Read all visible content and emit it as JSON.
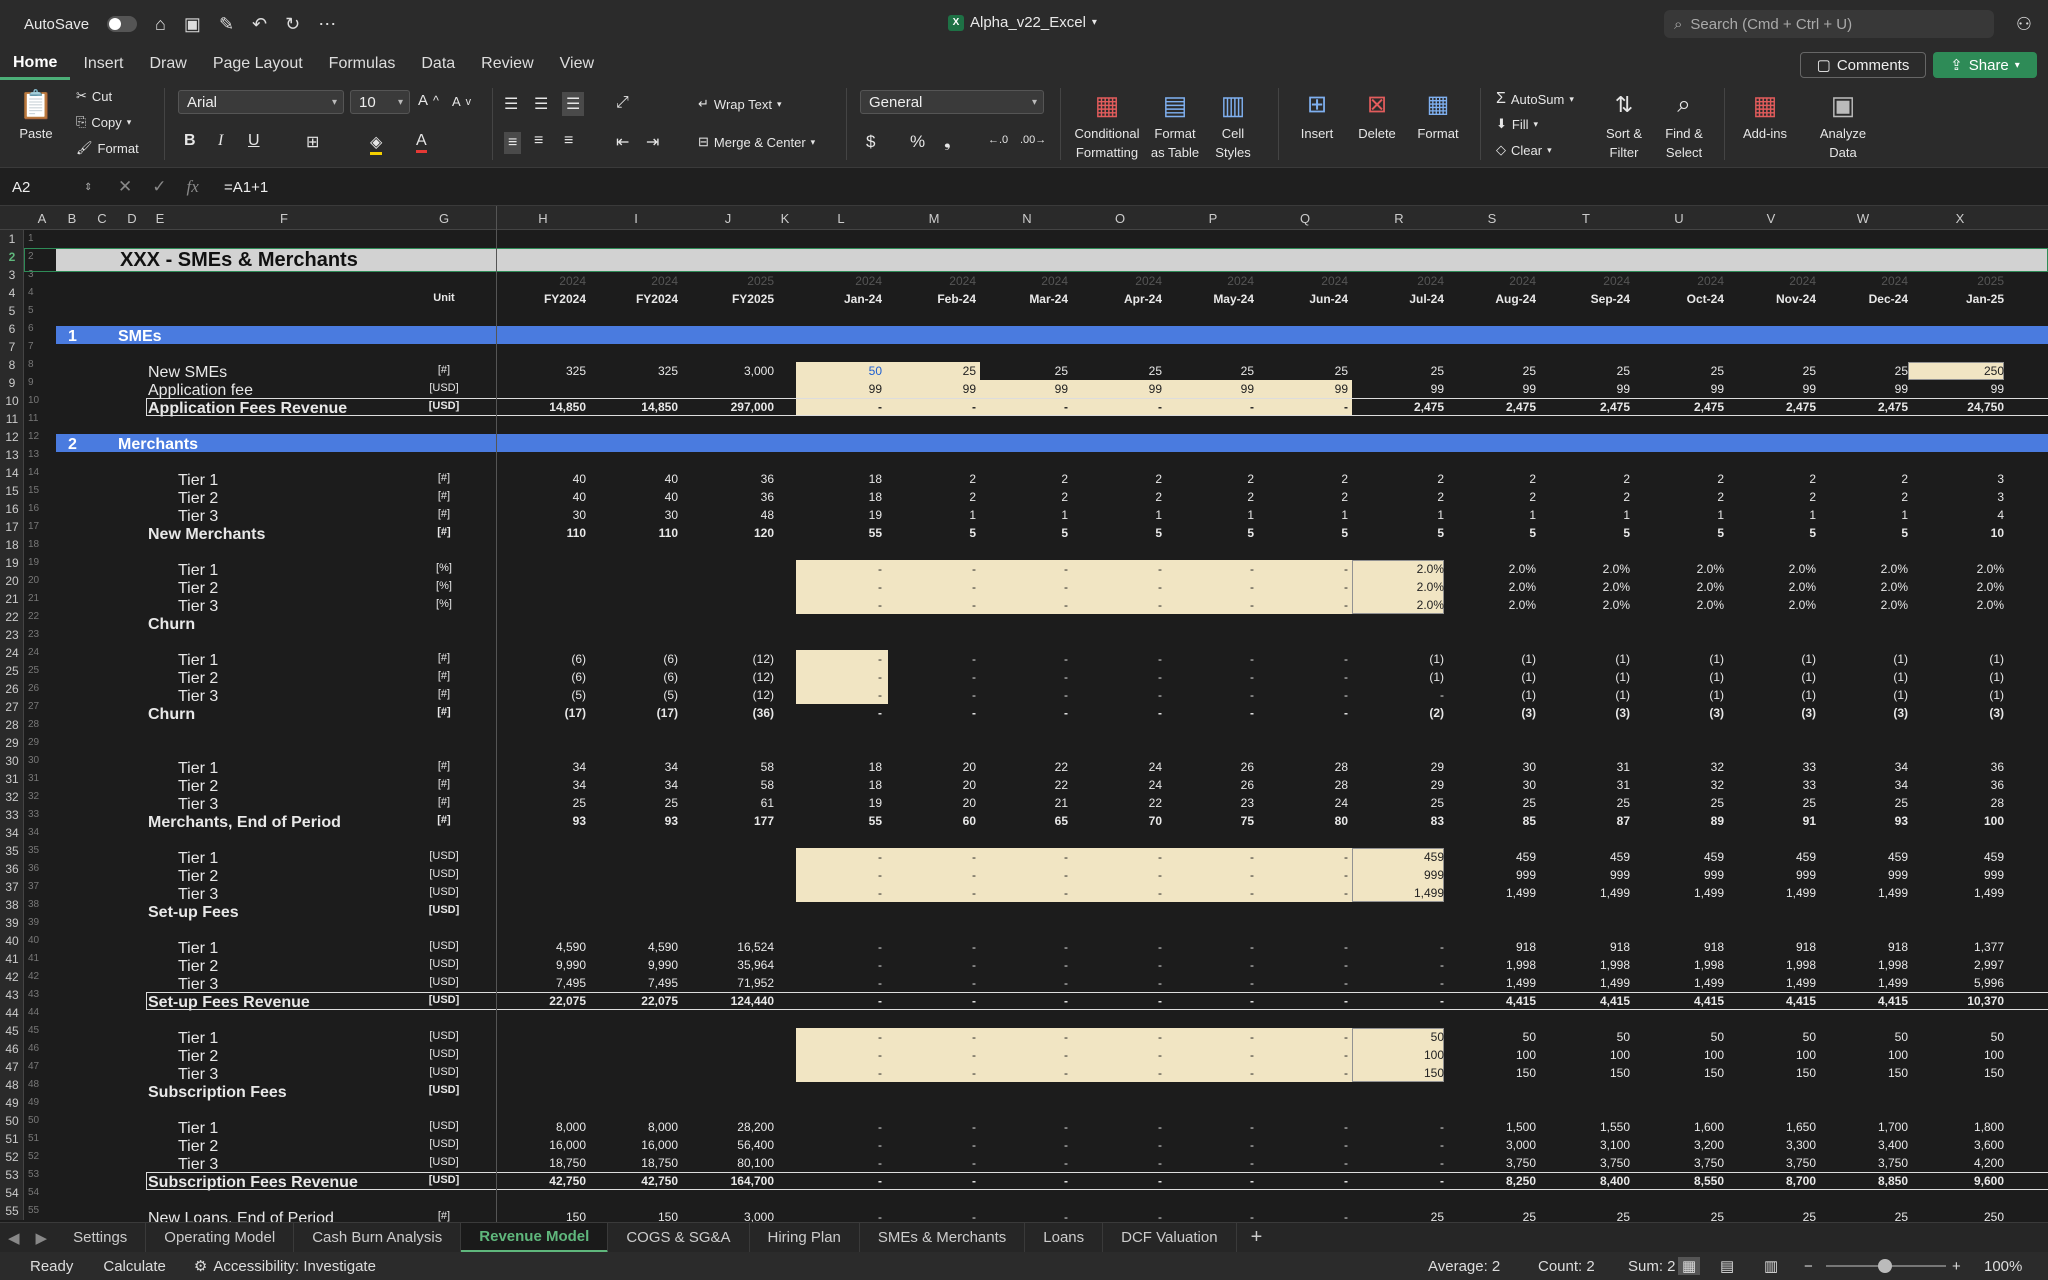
{
  "titlebar": {
    "autosave": "AutoSave",
    "title": "Alpha_v22_Excel",
    "search_placeholder": "Search (Cmd + Ctrl + U)"
  },
  "ribbon_tabs": [
    {
      "label": "Home",
      "active": true
    },
    {
      "label": "Insert"
    },
    {
      "label": "Draw"
    },
    {
      "label": "Page Layout"
    },
    {
      "label": "Formulas"
    },
    {
      "label": "Data"
    },
    {
      "label": "Review"
    },
    {
      "label": "View"
    }
  ],
  "buttons": {
    "comments": "Comments",
    "share": "Share"
  },
  "ribbon": {
    "paste": "Paste",
    "cut": "Cut",
    "copy": "Copy",
    "format": "Format",
    "font": "Arial",
    "size": "10",
    "wrap": "Wrap Text",
    "merge": "Merge & Center",
    "number_format": "General",
    "cond1": "Conditional",
    "cond2": "Formatting",
    "fmt1": "Format",
    "fmt2": "as Table",
    "cell1": "Cell",
    "cell2": "Styles",
    "insert": "Insert",
    "delete": "Delete",
    "format2": "Format",
    "autosum": "AutoSum",
    "fill": "Fill",
    "clear": "Clear",
    "sort1": "Sort &",
    "sort2": "Filter",
    "find1": "Find &",
    "find2": "Select",
    "addins": "Add-ins",
    "analyze1": "Analyze",
    "analyze2": "Data",
    "bold": "B",
    "italic": "I",
    "underline": "U"
  },
  "formula_bar": {
    "cell": "A2",
    "formula": "=A1+1"
  },
  "columns": [
    "A",
    "B",
    "C",
    "D",
    "E",
    "F",
    "G",
    "H",
    "I",
    "J",
    "K",
    "L",
    "M",
    "N",
    "O",
    "P",
    "Q",
    "R",
    "S",
    "T",
    "U",
    "V",
    "W",
    "X"
  ],
  "sheet": {
    "title": "XXX - SMEs & Merchants",
    "year_row": [
      "2024",
      "2024",
      "2025",
      "2024",
      "2024",
      "2024",
      "2024",
      "2024",
      "2024",
      "2024",
      "2024",
      "2024",
      "2024",
      "2024",
      "2024",
      "2025"
    ],
    "unit_header": "Unit",
    "period_row": [
      "FY2024",
      "FY2024",
      "FY2025",
      "Jan-24",
      "Feb-24",
      "Mar-24",
      "Apr-24",
      "May-24",
      "Jun-24",
      "Jul-24",
      "Aug-24",
      "Sep-24",
      "Oct-24",
      "Nov-24",
      "Dec-24",
      "Jan-25"
    ],
    "sections": [
      {
        "row": 6,
        "num": "1",
        "label": "SMEs"
      },
      {
        "row": 12,
        "num": "2",
        "label": "Merchants"
      }
    ],
    "rows": [
      {
        "r": 8,
        "indent": 1,
        "label": "New SMEs",
        "unit": "[#]",
        "v": [
          "325",
          "325",
          "3,000",
          "50",
          "25",
          "25",
          "25",
          "25",
          "25",
          "25",
          "25",
          "25",
          "25",
          "25",
          "25",
          "250"
        ]
      },
      {
        "r": 9,
        "indent": 1,
        "label": "Application fee",
        "unit": "[USD]",
        "v": [
          "",
          "",
          "",
          "99",
          "99",
          "99",
          "99",
          "99",
          "99",
          "99",
          "99",
          "99",
          "99",
          "99",
          "99",
          "99"
        ]
      },
      {
        "r": 10,
        "indent": 1,
        "label": "Application Fees Revenue",
        "unit": "[USD]",
        "bold": true,
        "v": [
          "14,850",
          "14,850",
          "297,000",
          "-",
          "-",
          "-",
          "-",
          "-",
          "-",
          "2,475",
          "2,475",
          "2,475",
          "2,475",
          "2,475",
          "2,475",
          "24,750"
        ]
      },
      {
        "r": 14,
        "indent": 2,
        "label": "Tier 1",
        "unit": "[#]",
        "v": [
          "40",
          "40",
          "36",
          "18",
          "2",
          "2",
          "2",
          "2",
          "2",
          "2",
          "2",
          "2",
          "2",
          "2",
          "2",
          "3"
        ]
      },
      {
        "r": 15,
        "indent": 2,
        "label": "Tier 2",
        "unit": "[#]",
        "v": [
          "40",
          "40",
          "36",
          "18",
          "2",
          "2",
          "2",
          "2",
          "2",
          "2",
          "2",
          "2",
          "2",
          "2",
          "2",
          "3"
        ]
      },
      {
        "r": 16,
        "indent": 2,
        "label": "Tier 3",
        "unit": "[#]",
        "v": [
          "30",
          "30",
          "48",
          "19",
          "1",
          "1",
          "1",
          "1",
          "1",
          "1",
          "1",
          "1",
          "1",
          "1",
          "1",
          "4"
        ]
      },
      {
        "r": 17,
        "indent": 1,
        "label": "New Merchants",
        "unit": "[#]",
        "bold": true,
        "v": [
          "110",
          "110",
          "120",
          "55",
          "5",
          "5",
          "5",
          "5",
          "5",
          "5",
          "5",
          "5",
          "5",
          "5",
          "5",
          "10"
        ]
      },
      {
        "r": 19,
        "indent": 2,
        "label": "Tier 1",
        "unit": "[%]",
        "v": [
          "",
          "",
          "",
          "-",
          "-",
          "-",
          "-",
          "-",
          "-",
          "2.0%",
          "2.0%",
          "2.0%",
          "2.0%",
          "2.0%",
          "2.0%",
          "2.0%"
        ]
      },
      {
        "r": 20,
        "indent": 2,
        "label": "Tier 2",
        "unit": "[%]",
        "v": [
          "",
          "",
          "",
          "-",
          "-",
          "-",
          "-",
          "-",
          "-",
          "2.0%",
          "2.0%",
          "2.0%",
          "2.0%",
          "2.0%",
          "2.0%",
          "2.0%"
        ]
      },
      {
        "r": 21,
        "indent": 2,
        "label": "Tier 3",
        "unit": "[%]",
        "v": [
          "",
          "",
          "",
          "-",
          "-",
          "-",
          "-",
          "-",
          "-",
          "2.0%",
          "2.0%",
          "2.0%",
          "2.0%",
          "2.0%",
          "2.0%",
          "2.0%"
        ]
      },
      {
        "r": 22,
        "indent": 1,
        "label": "Churn",
        "unit": "",
        "bold": true,
        "v": []
      },
      {
        "r": 24,
        "indent": 2,
        "label": "Tier 1",
        "unit": "[#]",
        "v": [
          "(6)",
          "(6)",
          "(12)",
          "-",
          "-",
          "-",
          "-",
          "-",
          "-",
          "(1)",
          "(1)",
          "(1)",
          "(1)",
          "(1)",
          "(1)",
          "(1)"
        ]
      },
      {
        "r": 25,
        "indent": 2,
        "label": "Tier 2",
        "unit": "[#]",
        "v": [
          "(6)",
          "(6)",
          "(12)",
          "-",
          "-",
          "-",
          "-",
          "-",
          "-",
          "(1)",
          "(1)",
          "(1)",
          "(1)",
          "(1)",
          "(1)",
          "(1)"
        ]
      },
      {
        "r": 26,
        "indent": 2,
        "label": "Tier 3",
        "unit": "[#]",
        "v": [
          "(5)",
          "(5)",
          "(12)",
          "-",
          "-",
          "-",
          "-",
          "-",
          "-",
          "-",
          "(1)",
          "(1)",
          "(1)",
          "(1)",
          "(1)",
          "(1)"
        ]
      },
      {
        "r": 27,
        "indent": 1,
        "label": "Churn",
        "unit": "[#]",
        "bold": true,
        "v": [
          "(17)",
          "(17)",
          "(36)",
          "-",
          "-",
          "-",
          "-",
          "-",
          "-",
          "(2)",
          "(3)",
          "(3)",
          "(3)",
          "(3)",
          "(3)",
          "(3)"
        ]
      },
      {
        "r": 30,
        "indent": 2,
        "label": "Tier 1",
        "unit": "[#]",
        "v": [
          "34",
          "34",
          "58",
          "18",
          "20",
          "22",
          "24",
          "26",
          "28",
          "29",
          "30",
          "31",
          "32",
          "33",
          "34",
          "36"
        ]
      },
      {
        "r": 31,
        "indent": 2,
        "label": "Tier 2",
        "unit": "[#]",
        "v": [
          "34",
          "34",
          "58",
          "18",
          "20",
          "22",
          "24",
          "26",
          "28",
          "29",
          "30",
          "31",
          "32",
          "33",
          "34",
          "36"
        ]
      },
      {
        "r": 32,
        "indent": 2,
        "label": "Tier 3",
        "unit": "[#]",
        "v": [
          "25",
          "25",
          "61",
          "19",
          "20",
          "21",
          "22",
          "23",
          "24",
          "25",
          "25",
          "25",
          "25",
          "25",
          "25",
          "28"
        ]
      },
      {
        "r": 33,
        "indent": 1,
        "label": "Merchants, End of Period",
        "unit": "[#]",
        "bold": true,
        "v": [
          "93",
          "93",
          "177",
          "55",
          "60",
          "65",
          "70",
          "75",
          "80",
          "83",
          "85",
          "87",
          "89",
          "91",
          "93",
          "100"
        ]
      },
      {
        "r": 35,
        "indent": 2,
        "label": "Tier 1",
        "unit": "[USD]",
        "v": [
          "",
          "",
          "",
          "-",
          "-",
          "-",
          "-",
          "-",
          "-",
          "459",
          "459",
          "459",
          "459",
          "459",
          "459",
          "459"
        ]
      },
      {
        "r": 36,
        "indent": 2,
        "label": "Tier 2",
        "unit": "[USD]",
        "v": [
          "",
          "",
          "",
          "-",
          "-",
          "-",
          "-",
          "-",
          "-",
          "999",
          "999",
          "999",
          "999",
          "999",
          "999",
          "999"
        ]
      },
      {
        "r": 37,
        "indent": 2,
        "label": "Tier 3",
        "unit": "[USD]",
        "v": [
          "",
          "",
          "",
          "-",
          "-",
          "-",
          "-",
          "-",
          "-",
          "1,499",
          "1,499",
          "1,499",
          "1,499",
          "1,499",
          "1,499",
          "1,499"
        ]
      },
      {
        "r": 38,
        "indent": 1,
        "label": "Set-up Fees",
        "unit": "[USD]",
        "bold": true,
        "v": []
      },
      {
        "r": 40,
        "indent": 2,
        "label": "Tier 1",
        "unit": "[USD]",
        "v": [
          "4,590",
          "4,590",
          "16,524",
          "-",
          "-",
          "-",
          "-",
          "-",
          "-",
          "-",
          "918",
          "918",
          "918",
          "918",
          "918",
          "1,377"
        ]
      },
      {
        "r": 41,
        "indent": 2,
        "label": "Tier 2",
        "unit": "[USD]",
        "v": [
          "9,990",
          "9,990",
          "35,964",
          "-",
          "-",
          "-",
          "-",
          "-",
          "-",
          "-",
          "1,998",
          "1,998",
          "1,998",
          "1,998",
          "1,998",
          "2,997"
        ]
      },
      {
        "r": 42,
        "indent": 2,
        "label": "Tier 3",
        "unit": "[USD]",
        "v": [
          "7,495",
          "7,495",
          "71,952",
          "-",
          "-",
          "-",
          "-",
          "-",
          "-",
          "-",
          "1,499",
          "1,499",
          "1,499",
          "1,499",
          "1,499",
          "5,996"
        ]
      },
      {
        "r": 43,
        "indent": 1,
        "label": "Set-up Fees Revenue",
        "unit": "[USD]",
        "bold": true,
        "v": [
          "22,075",
          "22,075",
          "124,440",
          "-",
          "-",
          "-",
          "-",
          "-",
          "-",
          "-",
          "4,415",
          "4,415",
          "4,415",
          "4,415",
          "4,415",
          "10,370"
        ]
      },
      {
        "r": 45,
        "indent": 2,
        "label": "Tier 1",
        "unit": "[USD]",
        "v": [
          "",
          "",
          "",
          "-",
          "-",
          "-",
          "-",
          "-",
          "-",
          "50",
          "50",
          "50",
          "50",
          "50",
          "50",
          "50"
        ]
      },
      {
        "r": 46,
        "indent": 2,
        "label": "Tier 2",
        "unit": "[USD]",
        "v": [
          "",
          "",
          "",
          "-",
          "-",
          "-",
          "-",
          "-",
          "-",
          "100",
          "100",
          "100",
          "100",
          "100",
          "100",
          "100"
        ]
      },
      {
        "r": 47,
        "indent": 2,
        "label": "Tier 3",
        "unit": "[USD]",
        "v": [
          "",
          "",
          "",
          "-",
          "-",
          "-",
          "-",
          "-",
          "-",
          "150",
          "150",
          "150",
          "150",
          "150",
          "150",
          "150"
        ]
      },
      {
        "r": 48,
        "indent": 1,
        "label": "Subscription Fees",
        "unit": "[USD]",
        "bold": true,
        "v": []
      },
      {
        "r": 50,
        "indent": 2,
        "label": "Tier 1",
        "unit": "[USD]",
        "v": [
          "8,000",
          "8,000",
          "28,200",
          "-",
          "-",
          "-",
          "-",
          "-",
          "-",
          "-",
          "1,500",
          "1,550",
          "1,600",
          "1,650",
          "1,700",
          "1,800"
        ]
      },
      {
        "r": 51,
        "indent": 2,
        "label": "Tier 2",
        "unit": "[USD]",
        "v": [
          "16,000",
          "16,000",
          "56,400",
          "-",
          "-",
          "-",
          "-",
          "-",
          "-",
          "-",
          "3,000",
          "3,100",
          "3,200",
          "3,300",
          "3,400",
          "3,600"
        ]
      },
      {
        "r": 52,
        "indent": 2,
        "label": "Tier 3",
        "unit": "[USD]",
        "v": [
          "18,750",
          "18,750",
          "80,100",
          "-",
          "-",
          "-",
          "-",
          "-",
          "-",
          "-",
          "3,750",
          "3,750",
          "3,750",
          "3,750",
          "3,750",
          "4,200"
        ]
      },
      {
        "r": 53,
        "indent": 1,
        "label": "Subscription Fees Revenue",
        "unit": "[USD]",
        "bold": true,
        "v": [
          "42,750",
          "42,750",
          "164,700",
          "-",
          "-",
          "-",
          "-",
          "-",
          "-",
          "-",
          "8,250",
          "8,400",
          "8,550",
          "8,700",
          "8,850",
          "9,600"
        ]
      },
      {
        "r": 55,
        "indent": 1,
        "label": "New Loans, End of Period",
        "unit": "[#]",
        "v": [
          "150",
          "150",
          "3,000",
          "-",
          "-",
          "-",
          "-",
          "-",
          "-",
          "25",
          "25",
          "25",
          "25",
          "25",
          "25",
          "250"
        ]
      }
    ]
  },
  "sheet_tabs": [
    {
      "label": "Settings"
    },
    {
      "label": "Operating Model"
    },
    {
      "label": "Cash Burn Analysis"
    },
    {
      "label": "Revenue Model",
      "active": true
    },
    {
      "label": "COGS & SG&A"
    },
    {
      "label": "Hiring Plan"
    },
    {
      "label": "SMEs & Merchants"
    },
    {
      "label": "Loans"
    },
    {
      "label": "DCF Valuation"
    }
  ],
  "status": {
    "ready": "Ready",
    "calculate": "Calculate",
    "accessibility": "Accessibility: Investigate",
    "average": "Average: 2",
    "count": "Count: 2",
    "sum": "Sum: 2",
    "zoom": "100%"
  }
}
